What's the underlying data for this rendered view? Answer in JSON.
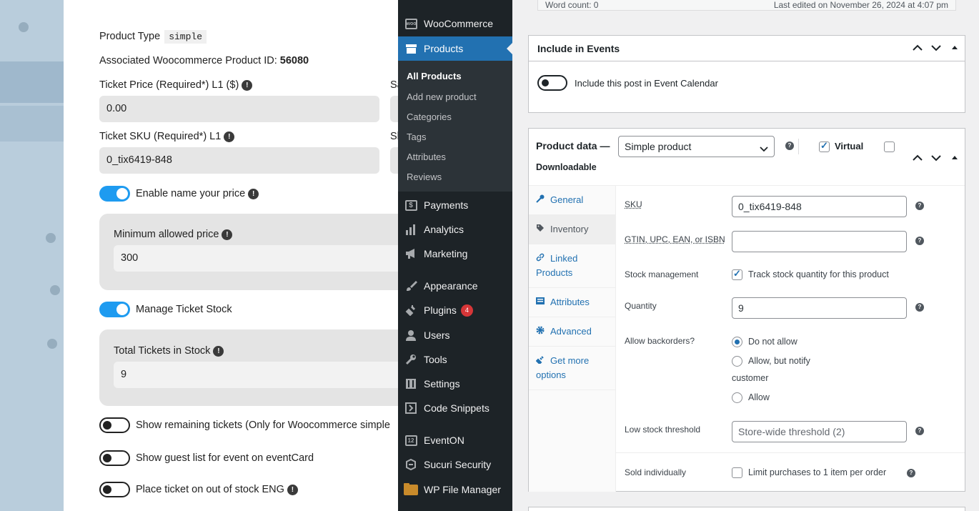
{
  "lightbox": {
    "product_type_label": "Product Type",
    "product_type_value": "simple",
    "assoc_label": "Associated Woocommerce Product ID:",
    "assoc_value": "56080",
    "ticket_price_label": "Ticket Price (Required*) L1 ($)",
    "ticket_price_value": "0.00",
    "sale_label_partial": "Sa",
    "ticket_sku_label": "Ticket SKU (Required*) L1",
    "ticket_sku_value": "0_tix6419-848",
    "sh_label_partial": "Sh",
    "name_your_price_label": "Enable name your price",
    "min_price_label": "Minimum allowed price",
    "min_price_value": "300",
    "manage_stock_label": "Manage Ticket Stock",
    "total_stock_label": "Total Tickets in Stock",
    "total_stock_value": "9",
    "remaining_label": "Show remaining tickets (Only for Woocommerce simple",
    "guest_list_label": "Show guest list for event on eventCard",
    "out_of_stock_label": "Place ticket on out of stock ENG",
    "help_glyph": "!"
  },
  "sidebar": {
    "items": [
      {
        "label": "WooCommerce",
        "icon": "woo-icon"
      },
      {
        "label": "Products",
        "icon": "products-icon",
        "active": true
      },
      {
        "label": "Payments",
        "icon": "payments-icon"
      },
      {
        "label": "Analytics",
        "icon": "analytics-icon"
      },
      {
        "label": "Marketing",
        "icon": "marketing-icon"
      },
      {
        "label": "Appearance",
        "icon": "brush-icon"
      },
      {
        "label": "Plugins",
        "icon": "plugin-icon",
        "badge": "4"
      },
      {
        "label": "Users",
        "icon": "users-icon"
      },
      {
        "label": "Tools",
        "icon": "wrench-icon"
      },
      {
        "label": "Settings",
        "icon": "settings-icon"
      },
      {
        "label": "Code Snippets",
        "icon": "snippets-icon"
      },
      {
        "label": "EventON",
        "icon": "eventon-icon"
      },
      {
        "label": "Sucuri Security",
        "icon": "sucuri-icon"
      },
      {
        "label": "WP File Manager",
        "icon": "file-manager-icon"
      }
    ],
    "submenu": [
      "All Products",
      "Add new product",
      "Categories",
      "Tags",
      "Attributes",
      "Reviews"
    ],
    "woo_glyph": "woo",
    "eventon_glyph": "12",
    "payments_glyph": "$"
  },
  "editor": {
    "word_count": "Word count: 0",
    "last_edited": "Last edited on November 26, 2024 at 4:07 pm"
  },
  "include_events": {
    "title": "Include in Events",
    "toggle_label": "Include this post in Event Calendar"
  },
  "product_data": {
    "title": "Product data —",
    "type_select": "Simple product",
    "virtual_label": "Virtual",
    "downloadable_label": "Downloadable",
    "tabs": [
      "General",
      "Inventory",
      "Linked Products",
      "Attributes",
      "Advanced",
      "Get more options"
    ],
    "sku_label": "SKU",
    "sku_value": "0_tix6419-848",
    "gtin_label": "GTIN, UPC, EAN, or ISBN",
    "gtin_value": "",
    "stock_mgmt_label": "Stock management",
    "stock_mgmt_text": "Track stock quantity for this product",
    "quantity_label": "Quantity",
    "quantity_value": "9",
    "backorders_label": "Allow backorders?",
    "backorder_options": [
      "Do not allow",
      "Allow, but notify",
      "customer",
      "Allow"
    ],
    "low_stock_label": "Low stock threshold",
    "low_stock_placeholder": "Store-wide threshold (2)",
    "sold_individually_label": "Sold individually",
    "sold_individually_text": "Limit purchases to 1 item per order",
    "qmark_glyph": "?"
  },
  "colors": {
    "wp_blue": "#2271b1",
    "sidebar_bg": "#1d2327",
    "toggle_blue": "#1e9bf0",
    "badge_red": "#d63638"
  }
}
